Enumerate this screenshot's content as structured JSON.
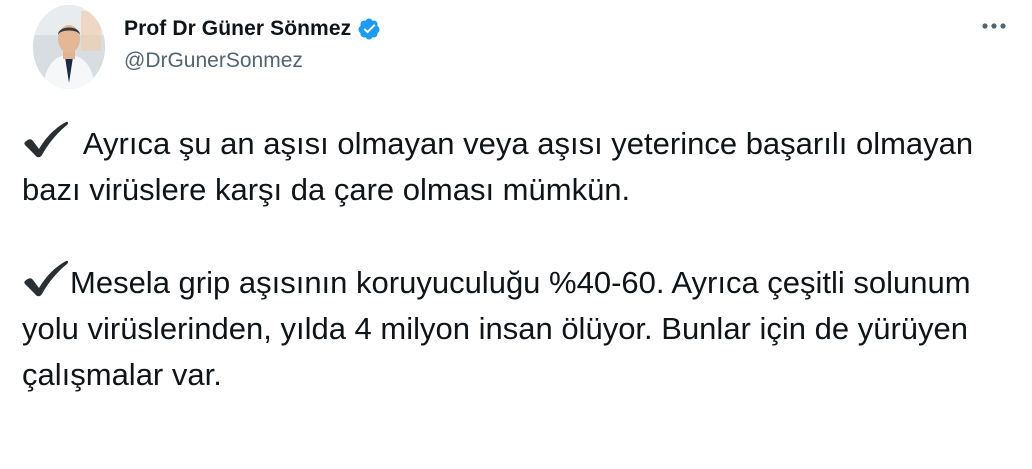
{
  "author": {
    "display_name": "Prof Dr Güner Sönmez",
    "handle": "@DrGunerSonmez",
    "verified": true,
    "avatar_icon": "profile-photo"
  },
  "menu": {
    "more_icon": "more-options-icon"
  },
  "tweet": {
    "paragraphs": [
      {
        "bullet_icon": "check-mark-icon",
        "text": " Ayrıca şu an aşısı olmayan veya aşısı yeterince başarılı olmayan bazı virüslere karşı da çare olması mümkün."
      },
      {
        "bullet_icon": "check-mark-icon",
        "text": "Mesela grip aşısının koruyuculuğu %40-60. Ayrıca çeşitli solunum yolu virüslerinden, yılda 4 milyon insan ölüyor. Bunlar için de yürüyen çalışmalar var."
      }
    ]
  },
  "colors": {
    "text": "#0f1419",
    "secondary_text": "#536471",
    "verified_blue": "#1d9bf0"
  }
}
